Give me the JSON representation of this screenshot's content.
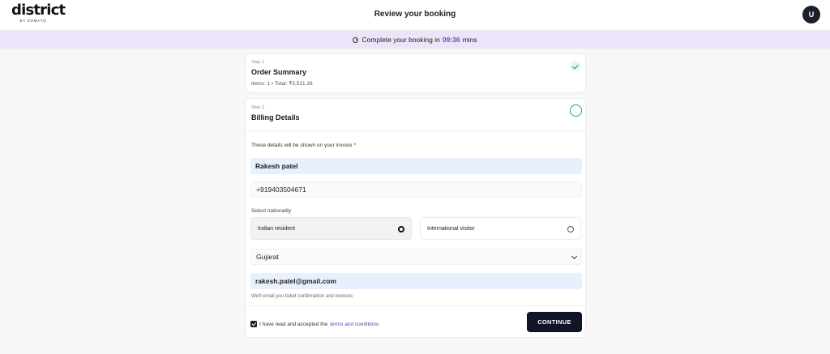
{
  "header": {
    "logo_text": "district",
    "logo_subtext": "BY ZOMATO",
    "title": "Review your booking",
    "avatar_initial": "U"
  },
  "timer": {
    "prefix": "Complete your booking in",
    "value": "09:36",
    "suffix": "mins",
    "icon": "stopwatch-icon"
  },
  "step1": {
    "label": "Step 1",
    "title": "Order Summary",
    "meta": "Items: 1 • Total: ₹5,521.26",
    "status_icon": "check-icon"
  },
  "step2": {
    "label": "Step 2",
    "title": "Billing Details",
    "invoice_note": "These details will be shown on your invoice *",
    "name_value": "Rakesh patel",
    "phone_value": "+919403504671",
    "nationality_label": "Select nationality",
    "nationality_options": [
      {
        "label": "Indian resident",
        "selected": true
      },
      {
        "label": "International visitor",
        "selected": false
      }
    ],
    "state_value": "Gujarat",
    "email_value": "rakesh.patel@gmail.com",
    "email_helper": "We'll email you ticket confirmation and invoices",
    "terms_prefix": "I have read and accepted the",
    "terms_link": "terms and conditions",
    "terms_checked": true,
    "continue_label": "CONTINUE"
  },
  "colors": {
    "accent": "#7a3fd1",
    "timer_bg": "#ece4f8",
    "button_bg": "#101527",
    "success": "#1f9a4b",
    "input_fill": "#e8f0fe"
  }
}
